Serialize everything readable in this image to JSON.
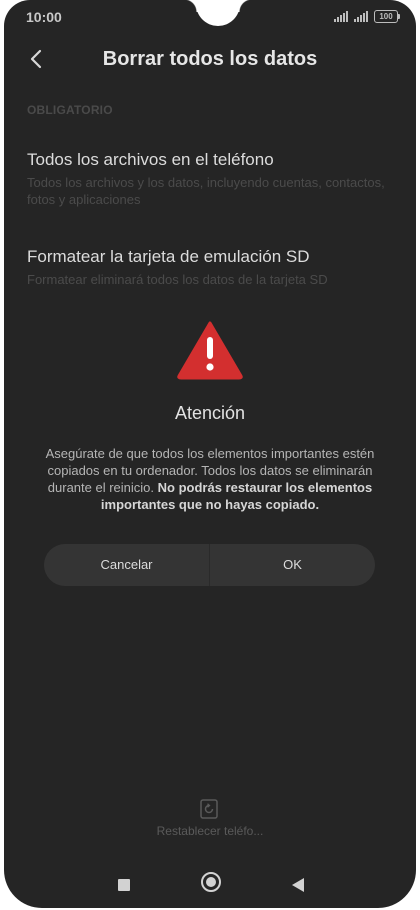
{
  "status_bar": {
    "time": "10:00",
    "battery": "100"
  },
  "header": {
    "title": "Borrar todos los datos",
    "back_icon": "chevron-left-icon"
  },
  "section": {
    "label": "OBLIGATORIO"
  },
  "options": [
    {
      "title": "Todos los archivos en el teléfono",
      "description": "Todos los archivos y los datos, incluyendo cuentas, contactos, fotos y aplicaciones"
    },
    {
      "title": "Formatear la tarjeta de emulación SD",
      "description": "Formatear eliminará todos los datos de la tarjeta SD"
    }
  ],
  "dialog": {
    "icon": "warning-triangle-icon",
    "title": "Atención",
    "message": "Asegúrate de que todos los elementos importantes estén copiados en tu ordenador. Todos los datos se eliminarán durante el reinicio.",
    "message_bold": "No podrás restaurar los elementos importantes que no hayas copiado.",
    "cancel_label": "Cancelar",
    "ok_label": "OK"
  },
  "reset": {
    "icon": "reset-icon",
    "label": "Restablecer teléfo..."
  },
  "nav": {
    "recent_icon": "square-icon",
    "home_icon": "circle-icon",
    "back_icon": "triangle-back-icon"
  },
  "colors": {
    "background": "#252525",
    "warning": "#d32f2f",
    "button_bg": "#343434"
  }
}
